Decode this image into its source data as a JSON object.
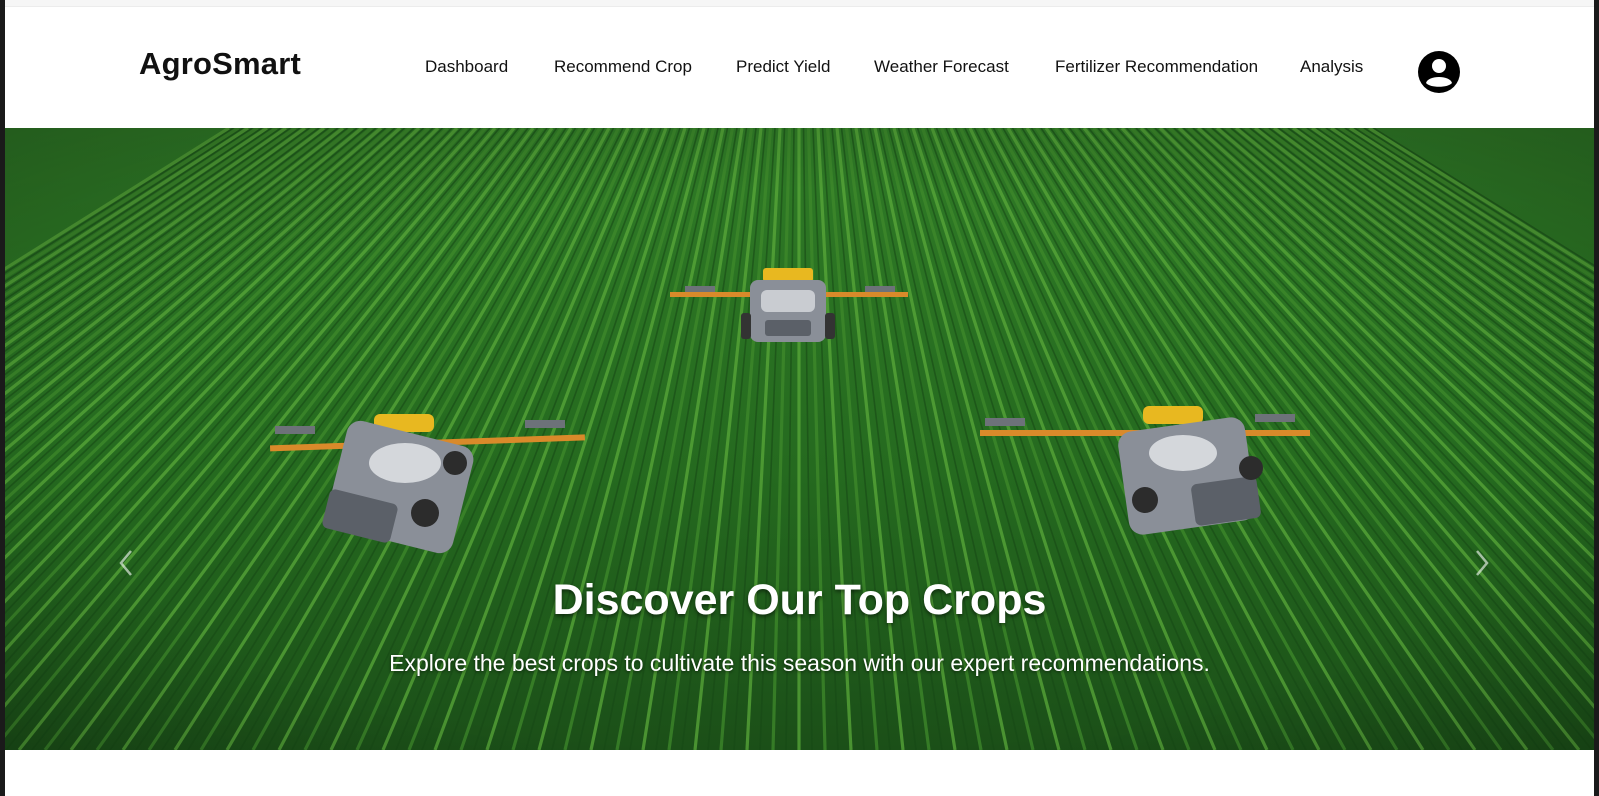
{
  "brand": {
    "name": "AgroSmart"
  },
  "nav": {
    "items": [
      {
        "label": "Dashboard"
      },
      {
        "label": "Recommend Crop"
      },
      {
        "label": "Predict Yield"
      },
      {
        "label": "Weather Forecast"
      },
      {
        "label": "Fertilizer Recommendation"
      },
      {
        "label": "Analysis"
      }
    ],
    "profile_icon": "user-circle-icon"
  },
  "hero": {
    "title": "Discover Our Top Crops",
    "subtitle": "Explore the best crops to cultivate this season with our expert recommendations.",
    "prev_icon": "chevron-left-icon",
    "next_icon": "chevron-right-icon"
  },
  "colors": {
    "field_dark": "#1f5a1c",
    "field_light": "#4c9a2f",
    "machine_yellow": "#e8b820",
    "machine_body": "#8a8f98",
    "boom_orange": "#d98a2a"
  }
}
